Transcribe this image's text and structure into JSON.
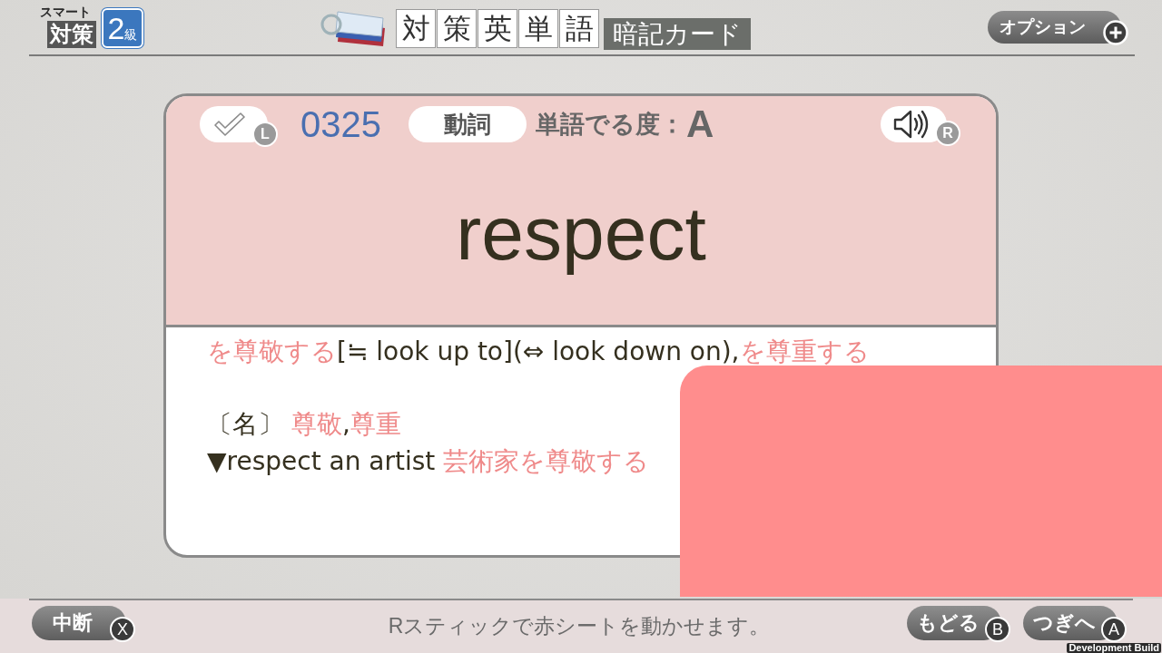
{
  "header": {
    "logo": {
      "tagline": "スマート",
      "title": "対策",
      "grade_number": "2",
      "grade_unit": "級"
    },
    "title_tiles": [
      "対",
      "策",
      "英",
      "単",
      "語"
    ],
    "subtitle": "暗記カード",
    "options_button": {
      "label": "オプション"
    }
  },
  "card": {
    "mark_button": {
      "checked": false,
      "key": "L"
    },
    "number": "0325",
    "part_of_speech": "動詞",
    "frequency": {
      "label": "単語でる度：",
      "rank": "A"
    },
    "audio_button": {
      "key": "R"
    },
    "word": "respect",
    "definition_lines": [
      {
        "segments": [
          {
            "text": "を尊敬する",
            "kind": "translation"
          },
          {
            "text": "[≒ look up to](⇔ look down on),",
            "kind": "text"
          },
          {
            "text": "を尊重する",
            "kind": "translation"
          }
        ]
      },
      {
        "segments": [
          {
            "text": "〔名〕 ",
            "kind": "text"
          },
          {
            "text": "尊敬",
            "kind": "translation"
          },
          {
            "text": ",",
            "kind": "text"
          },
          {
            "text": "尊重",
            "kind": "translation"
          }
        ]
      },
      {
        "segments": [
          {
            "text": "▼respect an artist ",
            "kind": "text"
          },
          {
            "text": "芸術家を尊敬する",
            "kind": "translation"
          }
        ]
      }
    ]
  },
  "cover_sheet": {
    "shown": true
  },
  "footer": {
    "left_buttons": [
      {
        "label": "中断",
        "key": "X"
      }
    ],
    "hint": "Rスティックで赤シートを動かせます。",
    "right_buttons": [
      {
        "label": "もどる",
        "key": "B"
      },
      {
        "label": "つぎへ",
        "key": "A"
      }
    ]
  },
  "development_label": "Development Build"
}
